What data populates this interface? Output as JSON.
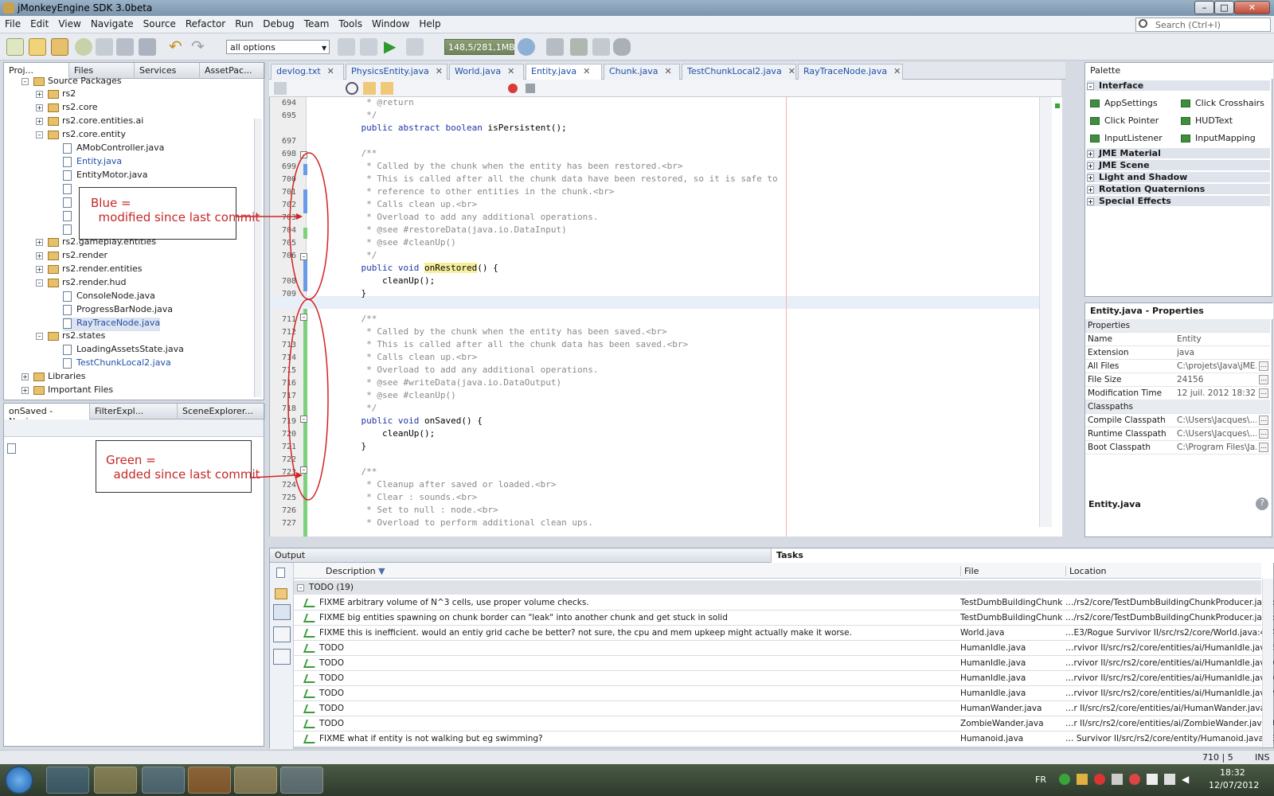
{
  "window": {
    "title": "jMonkeyEngine SDK 3.0beta"
  },
  "menu": [
    "File",
    "Edit",
    "View",
    "Navigate",
    "Source",
    "Refactor",
    "Run",
    "Debug",
    "Team",
    "Tools",
    "Window",
    "Help"
  ],
  "search": {
    "placeholder": "Search (Ctrl+I)"
  },
  "toolbar": {
    "config": "all options",
    "memory": "148,5/281,1MB"
  },
  "projects": {
    "tabs": [
      "Proj...",
      "Files",
      "Services",
      "AssetPac..."
    ],
    "items": [
      "Source Packages",
      "rs2",
      "rs2.core",
      "rs2.core.entities.ai",
      "rs2.core.entity",
      "AMobController.java",
      "Entity.java",
      "EntityMotor.java",
      "rs2.gameplay.entities",
      "rs2.render",
      "rs2.render.entities",
      "rs2.render.hud",
      "ConsoleNode.java",
      "ProgressBarNode.java",
      "RayTraceNode.java",
      "rs2.states",
      "LoadingAssetsState.java",
      "TestChunkLocal2.java",
      "Libraries",
      "Important Files"
    ]
  },
  "navigator": {
    "tabs": [
      "onSaved - Navig...",
      "FilterExpl...",
      "SceneExplorer..."
    ]
  },
  "editor": {
    "tabs": [
      "devlog.txt",
      "PhysicsEntity.java",
      "World.java",
      "Entity.java",
      "Chunk.java",
      "TestChunkLocal2.java",
      "RayTraceNode.java"
    ],
    "lines": [
      {
        "n": "694",
        "t": "     * @return"
      },
      {
        "n": "695",
        "t": "     */"
      },
      {
        "n": "",
        "t": "    public abstract boolean isPersistent();"
      },
      {
        "n": "697",
        "t": ""
      },
      {
        "n": "698",
        "t": "    /**"
      },
      {
        "n": "699",
        "t": "     * Called by the chunk when the entity has been restored.<br>"
      },
      {
        "n": "700",
        "t": "     * This is called after all the chunk data have been restored, so it is safe to"
      },
      {
        "n": "701",
        "t": "     * reference to other entities in the chunk.<br>"
      },
      {
        "n": "702",
        "t": "     * Calls clean up.<br>"
      },
      {
        "n": "703",
        "t": "     * Overload to add any additional operations."
      },
      {
        "n": "704",
        "t": "     * @see #restoreData(java.io.DataInput)"
      },
      {
        "n": "705",
        "t": "     * @see #cleanUp()"
      },
      {
        "n": "706",
        "t": "     */"
      },
      {
        "n": "",
        "t": "    public void onRestored() {"
      },
      {
        "n": "708",
        "t": "        cleanUp();"
      },
      {
        "n": "709",
        "t": "    }"
      },
      {
        "n": "710",
        "t": ""
      },
      {
        "n": "711",
        "t": "    /**"
      },
      {
        "n": "712",
        "t": "     * Called by the chunk when the entity has been saved.<br>"
      },
      {
        "n": "713",
        "t": "     * This is called after all the chunk data has been saved.<br>"
      },
      {
        "n": "714",
        "t": "     * Calls clean up.<br>"
      },
      {
        "n": "715",
        "t": "     * Overload to add any additional operations."
      },
      {
        "n": "716",
        "t": "     * @see #writeData(java.io.DataOutput)"
      },
      {
        "n": "717",
        "t": "     * @see #cleanUp()"
      },
      {
        "n": "718",
        "t": "     */"
      },
      {
        "n": "719",
        "t": "    public void onSaved() {"
      },
      {
        "n": "720",
        "t": "        cleanUp();"
      },
      {
        "n": "721",
        "t": "    }"
      },
      {
        "n": "722",
        "t": ""
      },
      {
        "n": "723",
        "t": "    /**"
      },
      {
        "n": "724",
        "t": "     * Cleanup after saved or loaded.<br>"
      },
      {
        "n": "725",
        "t": "     * Clear : sounds.<br>"
      },
      {
        "n": "726",
        "t": "     * Set to null : node.<br>"
      },
      {
        "n": "727",
        "t": "     * Overload to perform additional clean ups."
      }
    ]
  },
  "palette": {
    "title": "Palette",
    "section": "Interface",
    "items": [
      "AppSettings",
      "Click Crosshairs",
      "Click Pointer",
      "HUDText",
      "InputListener",
      "InputMapping"
    ],
    "categories": [
      "JME Material",
      "JME Scene",
      "Light and Shadow",
      "Rotation Quaternions",
      "Special Effects"
    ]
  },
  "properties": {
    "title": "Entity.java - Properties",
    "group1": "Properties",
    "rows1": [
      {
        "k": "Name",
        "v": "Entity"
      },
      {
        "k": "Extension",
        "v": "java"
      },
      {
        "k": "All Files",
        "v": "C:\\projets\\Java\\jME..."
      },
      {
        "k": "File Size",
        "v": "24156"
      },
      {
        "k": "Modification Time",
        "v": "12 juil. 2012 18:32:17"
      }
    ],
    "group2": "Classpaths",
    "rows2": [
      {
        "k": "Compile Classpath",
        "v": "C:\\Users\\Jacques\\..."
      },
      {
        "k": "Runtime Classpath",
        "v": "C:\\Users\\Jacques\\..."
      },
      {
        "k": "Boot Classpath",
        "v": "C:\\Program Files\\Ja..."
      }
    ],
    "footer": "Entity.java"
  },
  "tasks": {
    "tabs": [
      "Output",
      "Tasks"
    ],
    "columns": [
      "Description",
      "File",
      "Location"
    ],
    "group": "TODO (19)",
    "rows": [
      {
        "d": "FIXME arbitrary volume of N^3 cells, use proper volume checks.",
        "f": "TestDumbBuildingChunkP...",
        "l": "…/rs2/core/TestDumbBuildingChunkProducer.java:78"
      },
      {
        "d": "FIXME big entities spawning on chunk border can \"leak\" into another chunk and get stuck in solid",
        "f": "TestDumbBuildingChunkP...",
        "l": "…/rs2/core/TestDumbBuildingChunkProducer.java:87"
      },
      {
        "d": "FIXME this is inefficient. would an entiy grid cache be better? not sure, the cpu and mem upkeep might actually make it worse.",
        "f": "World.java",
        "l": "…E3/Rogue Survivor II/src/rs2/core/World.java:434"
      },
      {
        "d": "TODO",
        "f": "HumanIdle.java",
        "l": "…rvivor II/src/rs2/core/entities/ai/HumanIdle.java:56"
      },
      {
        "d": "TODO",
        "f": "HumanIdle.java",
        "l": "…rvivor II/src/rs2/core/entities/ai/HumanIdle.java:61"
      },
      {
        "d": "TODO",
        "f": "HumanIdle.java",
        "l": "…rvivor II/src/rs2/core/entities/ai/HumanIdle.java:66"
      },
      {
        "d": "TODO",
        "f": "HumanIdle.java",
        "l": "…rvivor II/src/rs2/core/entities/ai/HumanIdle.java:98"
      },
      {
        "d": "TODO",
        "f": "HumanWander.java",
        "l": "…r II/src/rs2/core/entities/ai/HumanWander.java:83"
      },
      {
        "d": "TODO",
        "f": "ZombieWander.java",
        "l": "…r II/src/rs2/core/entities/ai/ZombieWander.java:96"
      },
      {
        "d": "FIXME what if entity is not walking but eg swimming?",
        "f": "Humanoid.java",
        "l": "… Survivor II/src/rs2/core/entity/Humanoid.java:330"
      }
    ]
  },
  "annotations": {
    "blue": "Blue =\n  modified since last commit",
    "green": "Green =\n  added since last commit"
  },
  "status": {
    "pos": "710 | 5",
    "mode": "INS"
  },
  "taskbar": {
    "lang": "FR",
    "time": "18:32",
    "date": "12/07/2012"
  },
  "colors": {
    "modified": "#6a9be8",
    "added": "#7dd17d",
    "annotation": "#c62828"
  }
}
